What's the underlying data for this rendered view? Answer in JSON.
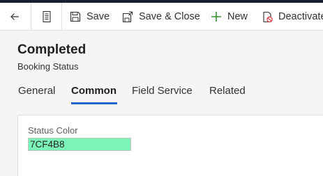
{
  "toolbar": {
    "back_icon": "arrow-left-icon",
    "record_icon": "form-icon",
    "save_label": "Save",
    "save_close_label": "Save & Close",
    "new_label": "New",
    "deactivate_label": "Deactivate"
  },
  "record": {
    "title": "Completed",
    "entity": "Booking Status"
  },
  "tabs": [
    {
      "label": "General",
      "active": false
    },
    {
      "label": "Common",
      "active": true
    },
    {
      "label": "Field Service",
      "active": false
    },
    {
      "label": "Related",
      "active": false
    }
  ],
  "fields": {
    "status_color": {
      "label": "Status Color",
      "value": "7CF4B8",
      "swatch": "#7CF4B8"
    }
  },
  "colors": {
    "accent": "#2266C8",
    "new_icon": "#107C10",
    "deactivate_icon": "#D13438"
  }
}
